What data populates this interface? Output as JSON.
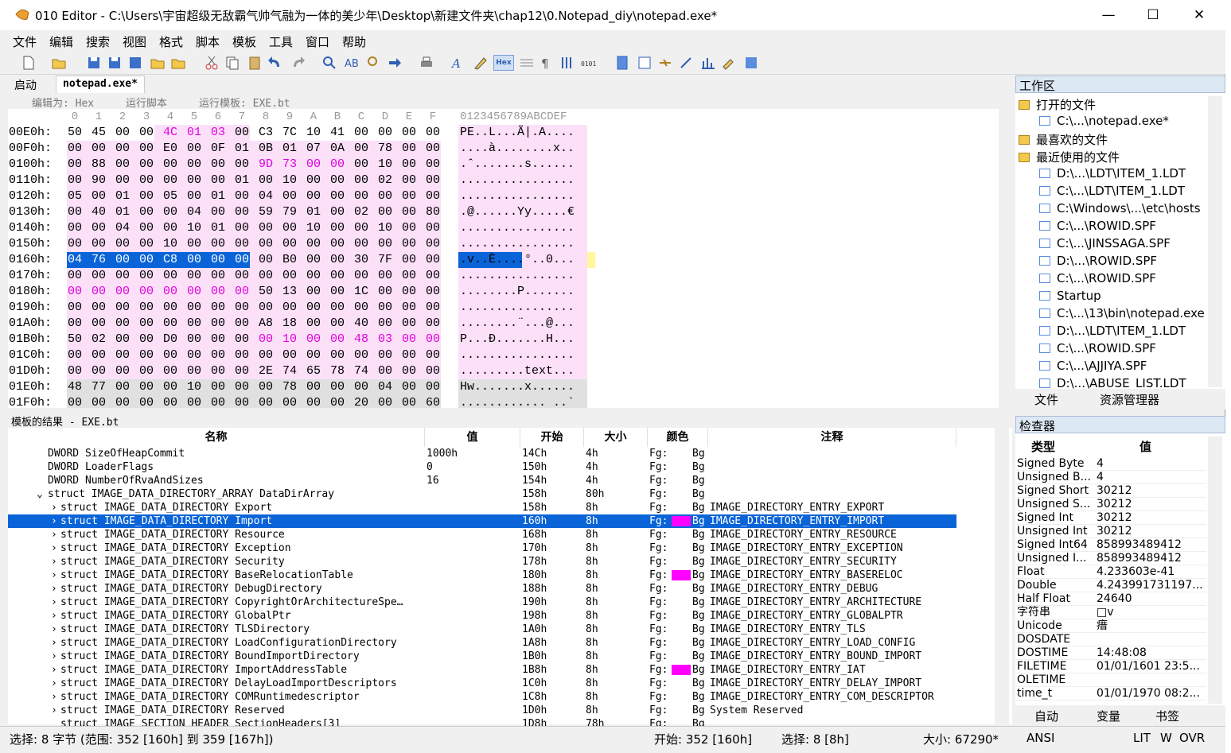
{
  "window": {
    "title": "010 Editor - C:\\Users\\宇宙超级无敌霸气帅气融为一体的美少年\\Desktop\\新建文件夹\\chap12\\0.Notepad_diy\\notepad.exe*",
    "min": "—",
    "max": "☐",
    "close": "✕"
  },
  "menu": [
    "文件",
    "编辑",
    "搜索",
    "视图",
    "格式",
    "脚本",
    "模板",
    "工具",
    "窗口",
    "帮助"
  ],
  "tabs": {
    "start": "启动",
    "file": "notepad.exe*"
  },
  "options": {
    "edit_as": "编辑为: Hex",
    "run_script": "运行脚本",
    "run_template": "运行模板: EXE.bt"
  },
  "hex": {
    "col_header": [
      "0",
      "1",
      "2",
      "3",
      "4",
      "5",
      "6",
      "7",
      "8",
      "9",
      "A",
      "B",
      "C",
      "D",
      "E",
      "F"
    ],
    "ascii_header": "0123456789ABCDEF",
    "rows": [
      {
        "addr": "00E0h:",
        "bytes": [
          "50",
          "45",
          "00",
          "00",
          "4C",
          "01",
          "03",
          "00",
          "C3",
          "7C",
          "10",
          "41",
          "00",
          "00",
          "00",
          "00"
        ],
        "ascii": "PE..L...Ã|.A...."
      },
      {
        "addr": "00F0h:",
        "bytes": [
          "00",
          "00",
          "00",
          "00",
          "E0",
          "00",
          "0F",
          "01",
          "0B",
          "01",
          "07",
          "0A",
          "00",
          "78",
          "00",
          "00"
        ],
        "ascii": "....à........x.."
      },
      {
        "addr": "0100h:",
        "bytes": [
          "00",
          "88",
          "00",
          "00",
          "00",
          "00",
          "00",
          "00",
          "9D",
          "73",
          "00",
          "00",
          "00",
          "10",
          "00",
          "00"
        ],
        "ascii": ".ˆ.......s......"
      },
      {
        "addr": "0110h:",
        "bytes": [
          "00",
          "90",
          "00",
          "00",
          "00",
          "00",
          "00",
          "01",
          "00",
          "10",
          "00",
          "00",
          "00",
          "02",
          "00",
          "00"
        ],
        "ascii": "................"
      },
      {
        "addr": "0120h:",
        "bytes": [
          "05",
          "00",
          "01",
          "00",
          "05",
          "00",
          "01",
          "00",
          "04",
          "00",
          "00",
          "00",
          "00",
          "00",
          "00",
          "00"
        ],
        "ascii": "................"
      },
      {
        "addr": "0130h:",
        "bytes": [
          "00",
          "40",
          "01",
          "00",
          "00",
          "04",
          "00",
          "00",
          "59",
          "79",
          "01",
          "00",
          "02",
          "00",
          "00",
          "80"
        ],
        "ascii": ".@......Yy.....€"
      },
      {
        "addr": "0140h:",
        "bytes": [
          "00",
          "00",
          "04",
          "00",
          "00",
          "10",
          "01",
          "00",
          "00",
          "00",
          "10",
          "00",
          "00",
          "10",
          "00",
          "00"
        ],
        "ascii": "................"
      },
      {
        "addr": "0150h:",
        "bytes": [
          "00",
          "00",
          "00",
          "00",
          "10",
          "00",
          "00",
          "00",
          "00",
          "00",
          "00",
          "00",
          "00",
          "00",
          "00",
          "00"
        ],
        "ascii": "................"
      },
      {
        "addr": "0160h:",
        "bytes": [
          "04",
          "76",
          "00",
          "00",
          "C8",
          "00",
          "00",
          "00",
          "00",
          "B0",
          "00",
          "00",
          "30",
          "7F",
          "00",
          "00"
        ],
        "ascii": ".v..È....°..0..."
      },
      {
        "addr": "0170h:",
        "bytes": [
          "00",
          "00",
          "00",
          "00",
          "00",
          "00",
          "00",
          "00",
          "00",
          "00",
          "00",
          "00",
          "00",
          "00",
          "00",
          "00"
        ],
        "ascii": "................"
      },
      {
        "addr": "0180h:",
        "bytes": [
          "00",
          "00",
          "00",
          "00",
          "00",
          "00",
          "00",
          "00",
          "50",
          "13",
          "00",
          "00",
          "1C",
          "00",
          "00",
          "00"
        ],
        "ascii": "........P......."
      },
      {
        "addr": "0190h:",
        "bytes": [
          "00",
          "00",
          "00",
          "00",
          "00",
          "00",
          "00",
          "00",
          "00",
          "00",
          "00",
          "00",
          "00",
          "00",
          "00",
          "00"
        ],
        "ascii": "................"
      },
      {
        "addr": "01A0h:",
        "bytes": [
          "00",
          "00",
          "00",
          "00",
          "00",
          "00",
          "00",
          "00",
          "A8",
          "18",
          "00",
          "00",
          "40",
          "00",
          "00",
          "00"
        ],
        "ascii": "........¨...@..."
      },
      {
        "addr": "01B0h:",
        "bytes": [
          "50",
          "02",
          "00",
          "00",
          "D0",
          "00",
          "00",
          "00",
          "00",
          "10",
          "00",
          "00",
          "48",
          "03",
          "00",
          "00"
        ],
        "ascii": "P...Ð.......H..."
      },
      {
        "addr": "01C0h:",
        "bytes": [
          "00",
          "00",
          "00",
          "00",
          "00",
          "00",
          "00",
          "00",
          "00",
          "00",
          "00",
          "00",
          "00",
          "00",
          "00",
          "00"
        ],
        "ascii": "................"
      },
      {
        "addr": "01D0h:",
        "bytes": [
          "00",
          "00",
          "00",
          "00",
          "00",
          "00",
          "00",
          "00",
          "2E",
          "74",
          "65",
          "78",
          "74",
          "00",
          "00",
          "00"
        ],
        "ascii": ".........text..."
      },
      {
        "addr": "01E0h:",
        "bytes": [
          "48",
          "77",
          "00",
          "00",
          "00",
          "10",
          "00",
          "00",
          "00",
          "78",
          "00",
          "00",
          "00",
          "04",
          "00",
          "00"
        ],
        "ascii": "Hw.......x......"
      },
      {
        "addr": "01F0h:",
        "bytes": [
          "00",
          "00",
          "00",
          "00",
          "00",
          "00",
          "00",
          "00",
          "00",
          "00",
          "00",
          "00",
          "20",
          "00",
          "00",
          "60"
        ],
        "ascii": "............ ..`"
      }
    ]
  },
  "template": {
    "title": "模板的结果 - EXE.bt",
    "headers": [
      "名称",
      "值",
      "开始",
      "大小",
      "颜色",
      "注释"
    ],
    "rows": [
      {
        "name": "DWORD SizeOfHeapCommit",
        "value": "1000h",
        "start": "14Ch",
        "size": "4h",
        "fg": "Fg:",
        "bg": "Bg",
        "comment": ""
      },
      {
        "name": "DWORD LoaderFlags",
        "value": "0",
        "start": "150h",
        "size": "4h",
        "fg": "Fg:",
        "bg": "Bg",
        "comment": ""
      },
      {
        "name": "DWORD NumberOfRvaAndSizes",
        "value": "16",
        "start": "154h",
        "size": "4h",
        "fg": "Fg:",
        "bg": "Bg",
        "comment": ""
      },
      {
        "name": "struct IMAGE_DATA_DIRECTORY_ARRAY DataDirArray",
        "value": "",
        "start": "158h",
        "size": "80h",
        "fg": "Fg:",
        "bg": "Bg",
        "comment": ""
      },
      {
        "name": "struct IMAGE_DATA_DIRECTORY Export",
        "value": "",
        "start": "158h",
        "size": "8h",
        "fg": "Fg:",
        "bg": "Bg",
        "comment": "IMAGE_DIRECTORY_ENTRY_EXPORT"
      },
      {
        "name": "struct IMAGE_DATA_DIRECTORY Import",
        "value": "",
        "start": "160h",
        "size": "8h",
        "fg": "Fg:",
        "bg": "Bg",
        "comment": "IMAGE_DIRECTORY_ENTRY_IMPORT"
      },
      {
        "name": "struct IMAGE_DATA_DIRECTORY Resource",
        "value": "",
        "start": "168h",
        "size": "8h",
        "fg": "Fg:",
        "bg": "Bg",
        "comment": "IMAGE_DIRECTORY_ENTRY_RESOURCE"
      },
      {
        "name": "struct IMAGE_DATA_DIRECTORY Exception",
        "value": "",
        "start": "170h",
        "size": "8h",
        "fg": "Fg:",
        "bg": "Bg",
        "comment": "IMAGE_DIRECTORY_ENTRY_EXCEPTION"
      },
      {
        "name": "struct IMAGE_DATA_DIRECTORY Security",
        "value": "",
        "start": "178h",
        "size": "8h",
        "fg": "Fg:",
        "bg": "Bg",
        "comment": "IMAGE_DIRECTORY_ENTRY_SECURITY"
      },
      {
        "name": "struct IMAGE_DATA_DIRECTORY BaseRelocationTable",
        "value": "",
        "start": "180h",
        "size": "8h",
        "fg": "Fg:",
        "bg": "Bg",
        "comment": "IMAGE_DIRECTORY_ENTRY_BASERELOC"
      },
      {
        "name": "struct IMAGE_DATA_DIRECTORY DebugDirectory",
        "value": "",
        "start": "188h",
        "size": "8h",
        "fg": "Fg:",
        "bg": "Bg",
        "comment": "IMAGE_DIRECTORY_ENTRY_DEBUG"
      },
      {
        "name": "struct IMAGE_DATA_DIRECTORY CopyrightOrArchitectureSpe…",
        "value": "",
        "start": "190h",
        "size": "8h",
        "fg": "Fg:",
        "bg": "Bg",
        "comment": "IMAGE_DIRECTORY_ENTRY_ARCHITECTURE"
      },
      {
        "name": "struct IMAGE_DATA_DIRECTORY GlobalPtr",
        "value": "",
        "start": "198h",
        "size": "8h",
        "fg": "Fg:",
        "bg": "Bg",
        "comment": "IMAGE_DIRECTORY_ENTRY_GLOBALPTR"
      },
      {
        "name": "struct IMAGE_DATA_DIRECTORY TLSDirectory",
        "value": "",
        "start": "1A0h",
        "size": "8h",
        "fg": "Fg:",
        "bg": "Bg",
        "comment": "IMAGE_DIRECTORY_ENTRY_TLS"
      },
      {
        "name": "struct IMAGE_DATA_DIRECTORY LoadConfigurationDirectory",
        "value": "",
        "start": "1A8h",
        "size": "8h",
        "fg": "Fg:",
        "bg": "Bg",
        "comment": "IMAGE_DIRECTORY_ENTRY_LOAD_CONFIG"
      },
      {
        "name": "struct IMAGE_DATA_DIRECTORY BoundImportDirectory",
        "value": "",
        "start": "1B0h",
        "size": "8h",
        "fg": "Fg:",
        "bg": "Bg",
        "comment": "IMAGE_DIRECTORY_ENTRY_BOUND_IMPORT"
      },
      {
        "name": "struct IMAGE_DATA_DIRECTORY ImportAddressTable",
        "value": "",
        "start": "1B8h",
        "size": "8h",
        "fg": "Fg:",
        "bg": "Bg",
        "comment": "IMAGE_DIRECTORY_ENTRY_IAT"
      },
      {
        "name": "struct IMAGE_DATA_DIRECTORY DelayLoadImportDescriptors",
        "value": "",
        "start": "1C0h",
        "size": "8h",
        "fg": "Fg:",
        "bg": "Bg",
        "comment": "IMAGE_DIRECTORY_ENTRY_DELAY_IMPORT"
      },
      {
        "name": "struct IMAGE_DATA_DIRECTORY COMRuntimedescriptor",
        "value": "",
        "start": "1C8h",
        "size": "8h",
        "fg": "Fg:",
        "bg": "Bg",
        "comment": "IMAGE_DIRECTORY_ENTRY_COM_DESCRIPTOR"
      },
      {
        "name": "struct IMAGE_DATA_DIRECTORY Reserved",
        "value": "",
        "start": "1D0h",
        "size": "8h",
        "fg": "Fg:",
        "bg": "Bg",
        "comment": "System Reserved"
      },
      {
        "name": "struct IMAGE_SECTION_HEADER SectionHeaders[3]",
        "value": "",
        "start": "1D8h",
        "size": "78h",
        "fg": "Fg:",
        "bg": "Bg",
        "comment": ""
      }
    ]
  },
  "workspace": {
    "title": "工作区",
    "open_files": "打开的文件",
    "open_file_1": "C:\\...\\notepad.exe*",
    "favorites": "最喜欢的文件",
    "recent": "最近使用的文件",
    "recent_files": [
      "D:\\...\\LDT\\ITEM_1.LDT",
      "C:\\...\\LDT\\ITEM_1.LDT",
      "C:\\Windows\\...\\etc\\hosts",
      "C:\\...\\ROWID.SPF",
      "C:\\...\\JINSSAGA.SPF",
      "D:\\...\\ROWID.SPF",
      "C:\\...\\ROWID.SPF",
      "Startup",
      "C:\\...\\13\\bin\\notepad.exe",
      "D:\\...\\LDT\\ITEM_1.LDT",
      "C:\\...\\ROWID.SPF",
      "C:\\...\\AJJIYA.SPF",
      "D:\\...\\ABUSE_LIST.LDT"
    ],
    "tab_files": "文件",
    "tab_explorer": "资源管理器"
  },
  "inspector": {
    "title": "检查器",
    "headers": [
      "类型",
      "值"
    ],
    "rows": [
      {
        "type": "Signed Byte",
        "value": "4"
      },
      {
        "type": "Unsigned B...",
        "value": "4"
      },
      {
        "type": "Signed Short",
        "value": "30212"
      },
      {
        "type": "Unsigned S...",
        "value": "30212"
      },
      {
        "type": "Signed Int",
        "value": "30212"
      },
      {
        "type": "Unsigned Int",
        "value": "30212"
      },
      {
        "type": "Signed Int64",
        "value": "858993489412"
      },
      {
        "type": "Unsigned I...",
        "value": "858993489412"
      },
      {
        "type": "Float",
        "value": "4.233603e-41"
      },
      {
        "type": "Double",
        "value": "4.243991731197..."
      },
      {
        "type": "Half Float",
        "value": "24640"
      },
      {
        "type": "字符串",
        "value": "□v"
      },
      {
        "type": "Unicode",
        "value": "瘄"
      },
      {
        "type": "DOSDATE",
        "value": ""
      },
      {
        "type": "DOSTIME",
        "value": "14:48:08"
      },
      {
        "type": "FILETIME",
        "value": "01/01/1601 23:5..."
      },
      {
        "type": "OLETIME",
        "value": ""
      },
      {
        "type": "time_t",
        "value": "01/01/1970 08:2..."
      }
    ],
    "tab_auto": "自动",
    "tab_vars": "变量",
    "tab_bookmarks": "书签"
  },
  "status": {
    "selection": "选择: 8 字节 (范围: 352 [160h] 到 359 [167h])",
    "start": "开始: 352 [160h]",
    "sel": "选择: 8 [8h]",
    "size": "大小: 67290*",
    "encoding": "ANSI",
    "lit": "LIT",
    "w": "W",
    "ovr": "OVR"
  },
  "colors": {
    "selection": "#0a64d8",
    "magenta": "#ff00ff",
    "pink_bg": "#fbe0f8",
    "grey_bg": "#e0e0e0",
    "panel_title": "#dde8f5"
  }
}
